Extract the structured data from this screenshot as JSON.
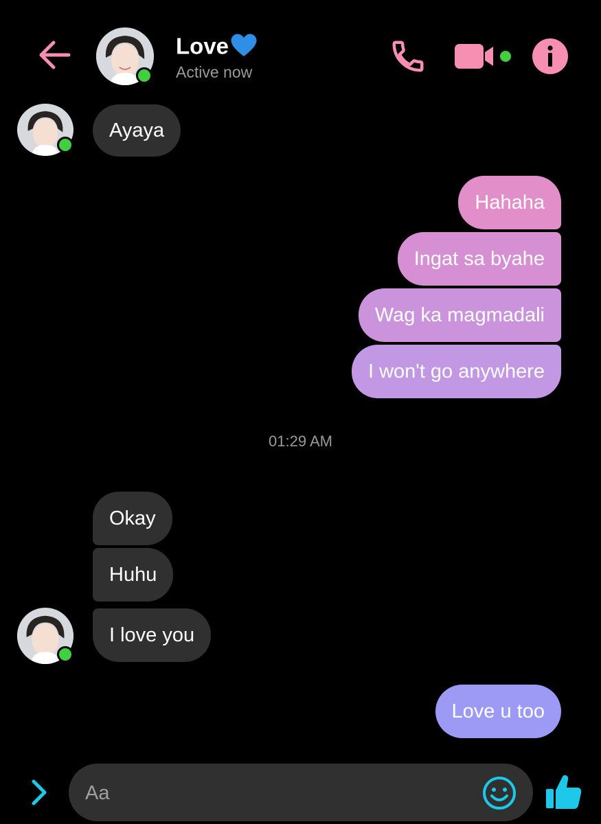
{
  "header": {
    "title": "Love",
    "title_emoji": "blue-heart",
    "status": "Active now",
    "accent_color": "#f78fb3",
    "icons": [
      "back-arrow-icon",
      "phone-icon",
      "video-camera-icon",
      "info-icon"
    ]
  },
  "messages": [
    {
      "text": "Ayaya",
      "from": "them"
    },
    {
      "text": "Hahaha",
      "from": "me"
    },
    {
      "text": "Ingat sa byahe",
      "from": "me"
    },
    {
      "text": "Wag ka magmadali",
      "from": "me"
    },
    {
      "text": "I won't go anywhere",
      "from": "me"
    },
    {
      "text": "Okay",
      "from": "them"
    },
    {
      "text": "Huhu",
      "from": "them"
    },
    {
      "text": "I love you",
      "from": "them"
    },
    {
      "text": "Love u too",
      "from": "me"
    }
  ],
  "timestamp": "01:29 AM",
  "composer": {
    "placeholder": "Aa",
    "accent_color": "#1ec8e8",
    "icons": [
      "expand-chevron-icon",
      "emoji-icon",
      "thumbs-up-icon"
    ]
  },
  "colors": {
    "background": "#000000",
    "incoming_bubble": "#303030",
    "outgoing_gradient": [
      "#e68ec8",
      "#cf92dc",
      "#c49ae6",
      "#9a9af4"
    ],
    "online": "#3fcf3f"
  }
}
